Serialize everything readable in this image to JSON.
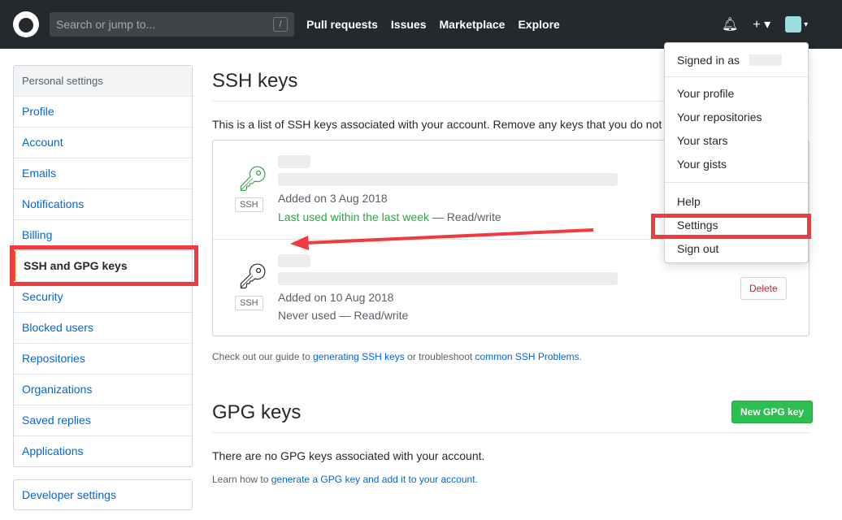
{
  "header": {
    "search_placeholder": "Search or jump to...",
    "slash": "/",
    "nav": [
      "Pull requests",
      "Issues",
      "Marketplace",
      "Explore"
    ],
    "bell": "bell-icon",
    "plus": "+ ▾",
    "avatar_caret": "▾"
  },
  "sidebar": {
    "title": "Personal settings",
    "items": [
      "Profile",
      "Account",
      "Emails",
      "Notifications",
      "Billing",
      "SSH and GPG keys",
      "Security",
      "Blocked users",
      "Repositories",
      "Organizations",
      "Saved replies",
      "Applications"
    ],
    "selected": "SSH and GPG keys",
    "developer": "Developer settings"
  },
  "ssh": {
    "title": "SSH keys",
    "description": "This is a list of SSH keys associated with your account. Remove any keys that you do not re",
    "keys": [
      {
        "badge": "SSH",
        "added": "Added on 3 Aug 2018",
        "last_used": "Last used within the last week",
        "access": " — Read/write",
        "color": "#28a745"
      },
      {
        "badge": "SSH",
        "added": "Added on 10 Aug 2018",
        "last_used": "Never used",
        "access": " — Read/write",
        "color": "#24292e",
        "delete": "Delete"
      }
    ],
    "guide_pre": "Check out our guide to ",
    "guide_link1": "generating SSH keys",
    "guide_mid": " or troubleshoot ",
    "guide_link2": "common SSH Problems",
    "guide_post": "."
  },
  "gpg": {
    "title": "GPG keys",
    "new_button": "New GPG key",
    "empty": "There are no GPG keys associated with your account.",
    "learn_pre": "Learn how to ",
    "learn_link": "generate a GPG key and add it to your account",
    "learn_post": "."
  },
  "dropdown": {
    "signed_in": "Signed in as",
    "items": [
      "Your profile",
      "Your repositories",
      "Your stars",
      "Your gists",
      "Help",
      "Settings",
      "Sign out"
    ]
  },
  "colors": {
    "header": "#24292e",
    "link": "#0366d6",
    "annotation": "#ef3a3f",
    "green": "#28a745",
    "delete": "#cb2431"
  }
}
